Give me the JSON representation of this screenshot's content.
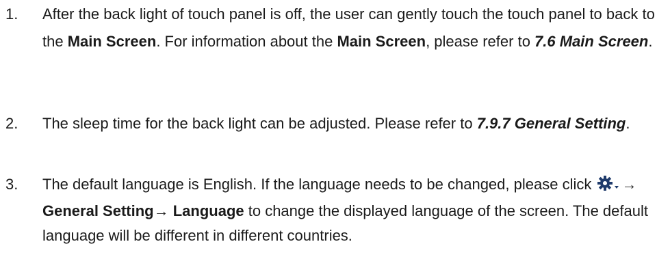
{
  "items": [
    {
      "number": "1.",
      "t1": "After the back light of touch panel is off, the user can gently touch the touch panel to back to the ",
      "b1": "Main Screen",
      "t2": ". For information about the ",
      "b2": "Main Screen",
      "t3": ", please refer to ",
      "bi1": "7.6 Main Screen",
      "t4": "."
    },
    {
      "number": "2.",
      "t1": "The sleep time for the back light can be adjusted. Please refer to ",
      "bi1": "7.9.7 General Setting",
      "t2": "."
    },
    {
      "number": "3.",
      "t1": "The default language is English. If the language needs to be changed, please click ",
      "icon": "gear-dropdown-icon",
      "arrow1": "→ ",
      "b1": "General Setting",
      "arrow2": "→ ",
      "b2": "Language",
      "t2": " to change the displayed language of the screen. The default language will be different in different countries."
    }
  ]
}
